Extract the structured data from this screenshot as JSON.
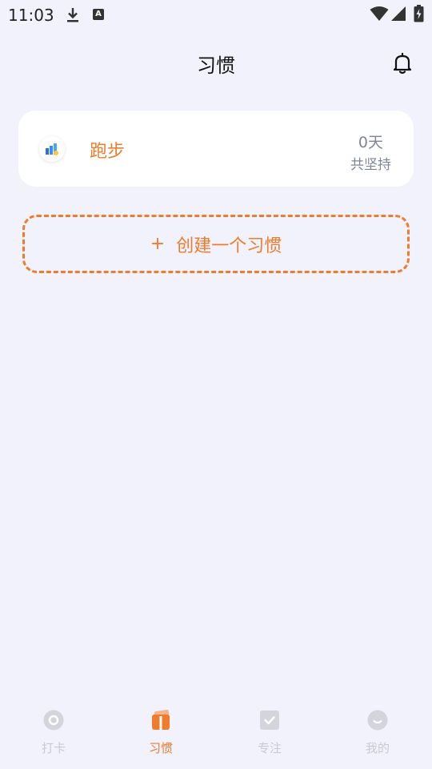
{
  "status_bar": {
    "time": "11:03",
    "icons": [
      "download-icon",
      "a-notification-icon",
      "wifi-icon",
      "signal-icon",
      "battery-icon"
    ]
  },
  "header": {
    "title": "习惯",
    "right_icon": "bell-icon"
  },
  "habits": [
    {
      "name": "跑步",
      "days": "0天",
      "sub": "共坚持",
      "icon": "running-habit-icon"
    }
  ],
  "create_button": {
    "plus": "+",
    "label": "创建一个习惯"
  },
  "bottom_nav": {
    "items": [
      {
        "label": "打卡",
        "icon": "checkin-icon",
        "active": false
      },
      {
        "label": "习惯",
        "icon": "habit-icon",
        "active": true
      },
      {
        "label": "专注",
        "icon": "focus-icon",
        "active": false
      },
      {
        "label": "我的",
        "icon": "profile-icon",
        "active": false
      }
    ]
  },
  "colors": {
    "accent": "#ee7c2c",
    "background": "#f2f2fc",
    "muted": "#7d8699",
    "nav_inactive": "#c9c9d2"
  }
}
